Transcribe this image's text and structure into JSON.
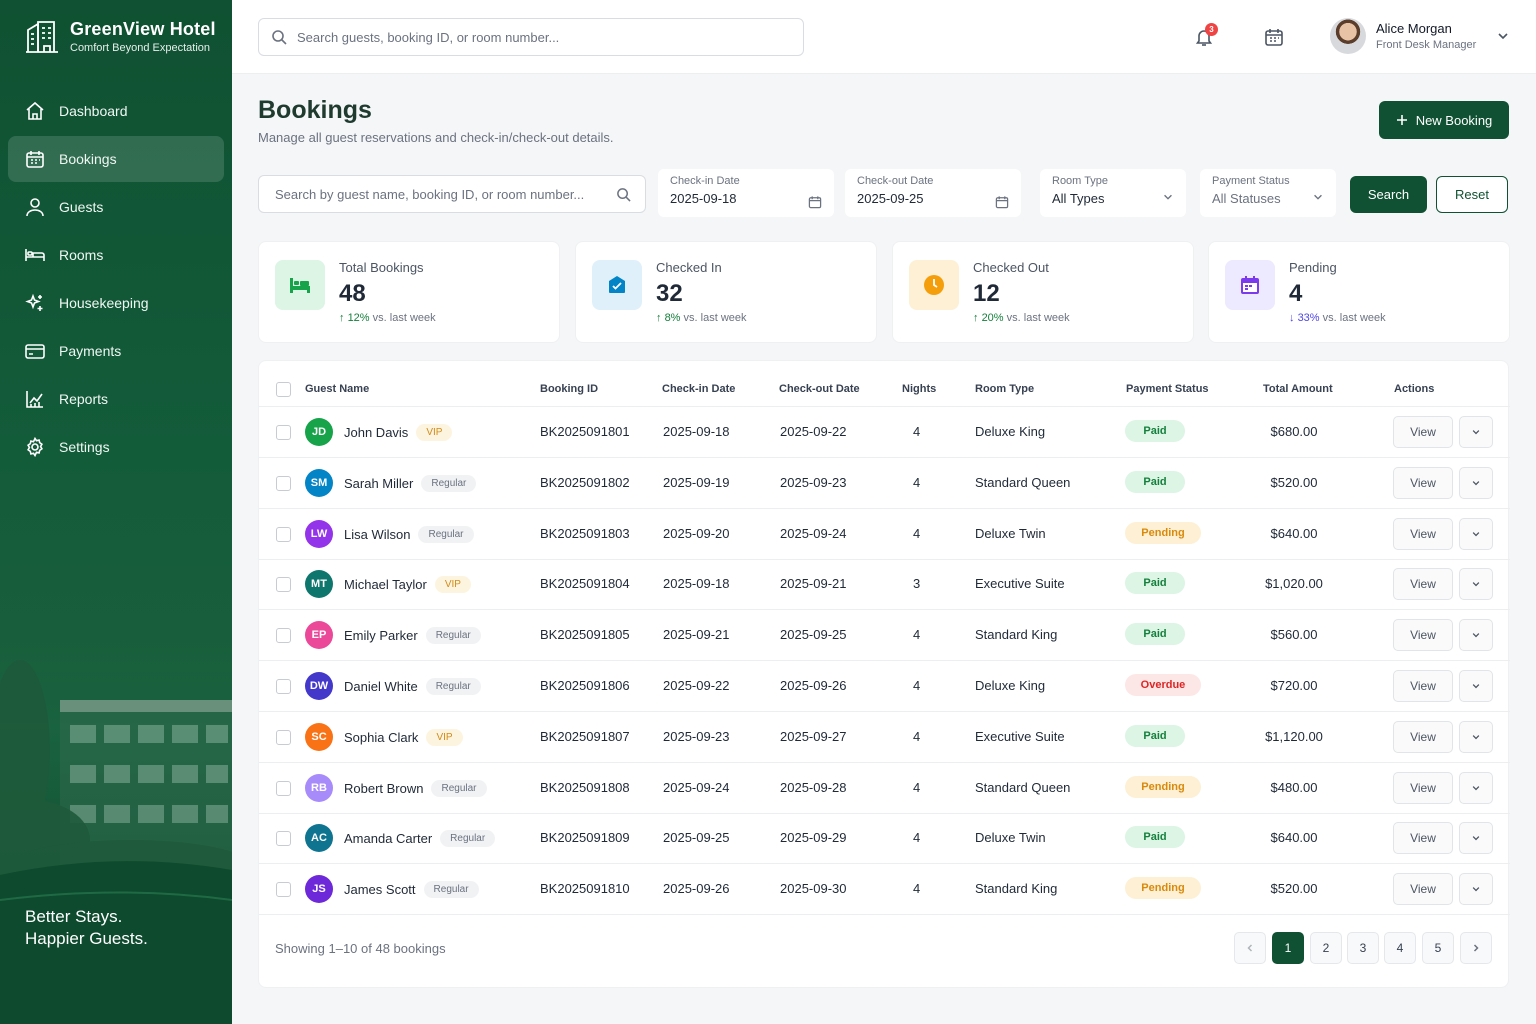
{
  "brand": {
    "name": "GreenView Hotel",
    "tagline": "Comfort Beyond Expectation"
  },
  "sidebar": {
    "items": [
      {
        "label": "Dashboard",
        "icon": "home-icon"
      },
      {
        "label": "Bookings",
        "icon": "calendar-icon",
        "active": true
      },
      {
        "label": "Guests",
        "icon": "user-icon"
      },
      {
        "label": "Rooms",
        "icon": "bed-icon"
      },
      {
        "label": "Housekeeping",
        "icon": "sparkle-icon"
      },
      {
        "label": "Payments",
        "icon": "card-icon"
      },
      {
        "label": "Reports",
        "icon": "chart-icon"
      },
      {
        "label": "Settings",
        "icon": "gear-icon"
      }
    ],
    "footer_line1": "Better Stays.",
    "footer_line2": "Happier Guests."
  },
  "topbar": {
    "search_placeholder": "Search guests, booking ID, or room number...",
    "notification_count": "3",
    "user": {
      "name": "Alice Morgan",
      "role": "Front Desk Manager"
    }
  },
  "page": {
    "title": "Bookings",
    "subtitle": "Manage all guest reservations and check-in/check-out details.",
    "new_button": "New Booking"
  },
  "filters": {
    "search_placeholder": "Search by guest name, booking ID, or room number...",
    "checkin_label": "Check-in Date",
    "checkin_value": "2025-09-18",
    "checkout_label": "Check-out Date",
    "checkout_value": "2025-09-25",
    "room_label": "Room Type",
    "room_value": "All Types",
    "payment_label": "Payment Status",
    "payment_value": "All Statuses",
    "search_button": "Search",
    "reset_button": "Reset"
  },
  "stats": [
    {
      "label": "Total Bookings",
      "value": "48",
      "trend": "12%",
      "trend_dir": "up",
      "trend_suffix": "vs. last week",
      "color": "#16a34a",
      "bg": "#dcf5e4",
      "icon": "bed-icon"
    },
    {
      "label": "Checked In",
      "value": "32",
      "trend": "8%",
      "trend_dir": "up",
      "trend_suffix": "vs. last week",
      "color": "#0284c7",
      "bg": "#dff0fb",
      "icon": "checkin-icon"
    },
    {
      "label": "Checked Out",
      "value": "12",
      "trend": "20%",
      "trend_dir": "up",
      "trend_suffix": "vs. last week",
      "color": "#f59e0b",
      "bg": "#fdf0d5",
      "icon": "clock-icon"
    },
    {
      "label": "Pending",
      "value": "4",
      "trend": "33%",
      "trend_dir": "down",
      "trend_suffix": "vs. last week",
      "color": "#7c3aed",
      "bg": "#ede9fe",
      "icon": "calendar-icon"
    }
  ],
  "table": {
    "headers": [
      "Guest Name",
      "Booking ID",
      "Check-in Date",
      "Check-out Date",
      "Nights",
      "Room Type",
      "Payment Status",
      "Total Amount",
      "Actions"
    ],
    "view_label": "View",
    "rows": [
      {
        "initials": "JD",
        "avatar_color": "#16a34a",
        "name": "John Davis",
        "tag": "VIP",
        "id": "BK2025091801",
        "checkin": "2025-09-18",
        "checkout": "2025-09-22",
        "nights": "4",
        "room": "Deluxe King",
        "status": "Paid",
        "amount": "$680.00"
      },
      {
        "initials": "SM",
        "avatar_color": "#0284c7",
        "name": "Sarah Miller",
        "tag": "Regular",
        "id": "BK2025091802",
        "checkin": "2025-09-19",
        "checkout": "2025-09-23",
        "nights": "4",
        "room": "Standard Queen",
        "status": "Paid",
        "amount": "$520.00"
      },
      {
        "initials": "LW",
        "avatar_color": "#9333ea",
        "name": "Lisa Wilson",
        "tag": "Regular",
        "id": "BK2025091803",
        "checkin": "2025-09-20",
        "checkout": "2025-09-24",
        "nights": "4",
        "room": "Deluxe Twin",
        "status": "Pending",
        "amount": "$640.00"
      },
      {
        "initials": "MT",
        "avatar_color": "#0f766e",
        "name": "Michael Taylor",
        "tag": "VIP",
        "id": "BK2025091804",
        "checkin": "2025-09-18",
        "checkout": "2025-09-21",
        "nights": "3",
        "room": "Executive Suite",
        "status": "Paid",
        "amount": "$1,020.00"
      },
      {
        "initials": "EP",
        "avatar_color": "#ec4899",
        "name": "Emily Parker",
        "tag": "Regular",
        "id": "BK2025091805",
        "checkin": "2025-09-21",
        "checkout": "2025-09-25",
        "nights": "4",
        "room": "Standard King",
        "status": "Paid",
        "amount": "$560.00"
      },
      {
        "initials": "DW",
        "avatar_color": "#4338ca",
        "name": "Daniel White",
        "tag": "Regular",
        "id": "BK2025091806",
        "checkin": "2025-09-22",
        "checkout": "2025-09-26",
        "nights": "4",
        "room": "Deluxe King",
        "status": "Overdue",
        "amount": "$720.00"
      },
      {
        "initials": "SC",
        "avatar_color": "#f97316",
        "name": "Sophia Clark",
        "tag": "VIP",
        "id": "BK2025091807",
        "checkin": "2025-09-23",
        "checkout": "2025-09-27",
        "nights": "4",
        "room": "Executive Suite",
        "status": "Paid",
        "amount": "$1,120.00"
      },
      {
        "initials": "RB",
        "avatar_color": "#a78bfa",
        "name": "Robert Brown",
        "tag": "Regular",
        "id": "BK2025091808",
        "checkin": "2025-09-24",
        "checkout": "2025-09-28",
        "nights": "4",
        "room": "Standard Queen",
        "status": "Pending",
        "amount": "$480.00"
      },
      {
        "initials": "AC",
        "avatar_color": "#0e7490",
        "name": "Amanda Carter",
        "tag": "Regular",
        "id": "BK2025091809",
        "checkin": "2025-09-25",
        "checkout": "2025-09-29",
        "nights": "4",
        "room": "Deluxe Twin",
        "status": "Paid",
        "amount": "$640.00"
      },
      {
        "initials": "JS",
        "avatar_color": "#6d28d9",
        "name": "James Scott",
        "tag": "Regular",
        "id": "BK2025091810",
        "checkin": "2025-09-26",
        "checkout": "2025-09-30",
        "nights": "4",
        "room": "Standard King",
        "status": "Pending",
        "amount": "$520.00"
      }
    ],
    "footer": "Showing 1–10 of 48 bookings",
    "pages": [
      "1",
      "2",
      "3",
      "4",
      "5"
    ],
    "current_page": "1"
  }
}
